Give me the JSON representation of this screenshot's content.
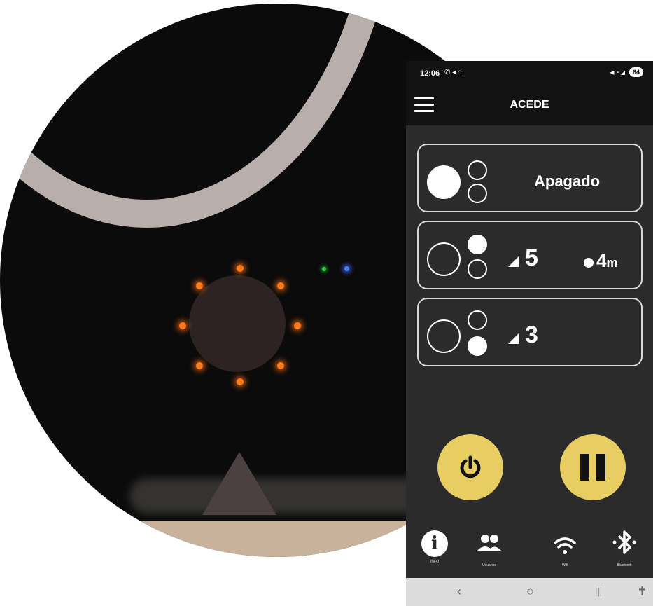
{
  "status_bar": {
    "time": "12:06",
    "left_icons": "✆ ◂ ⌂",
    "right_icons": "◀ ◔ ◢",
    "battery": "64"
  },
  "app": {
    "title": "ACEDE",
    "menu_icon": "menu-icon"
  },
  "modes": [
    {
      "label": "Apagado"
    },
    {
      "level": "5",
      "timer": "4",
      "timer_unit": "m"
    },
    {
      "level": "3"
    }
  ],
  "controls": {
    "power_icon": "power-icon",
    "pause_icon": "pause-icon",
    "accent": "#e8cd63"
  },
  "bottom_nav": [
    {
      "caption": "INFO",
      "icon": "info-icon",
      "glyph": "i"
    },
    {
      "caption": "Usuarios",
      "icon": "users-icon"
    },
    {
      "caption": "Wifi",
      "icon": "wifi-icon"
    },
    {
      "caption": "Bluetooth",
      "icon": "bluetooth-icon"
    }
  ],
  "system_nav": {
    "back": "‹",
    "home": "○",
    "recents": "|||",
    "accessibility": "✝"
  }
}
